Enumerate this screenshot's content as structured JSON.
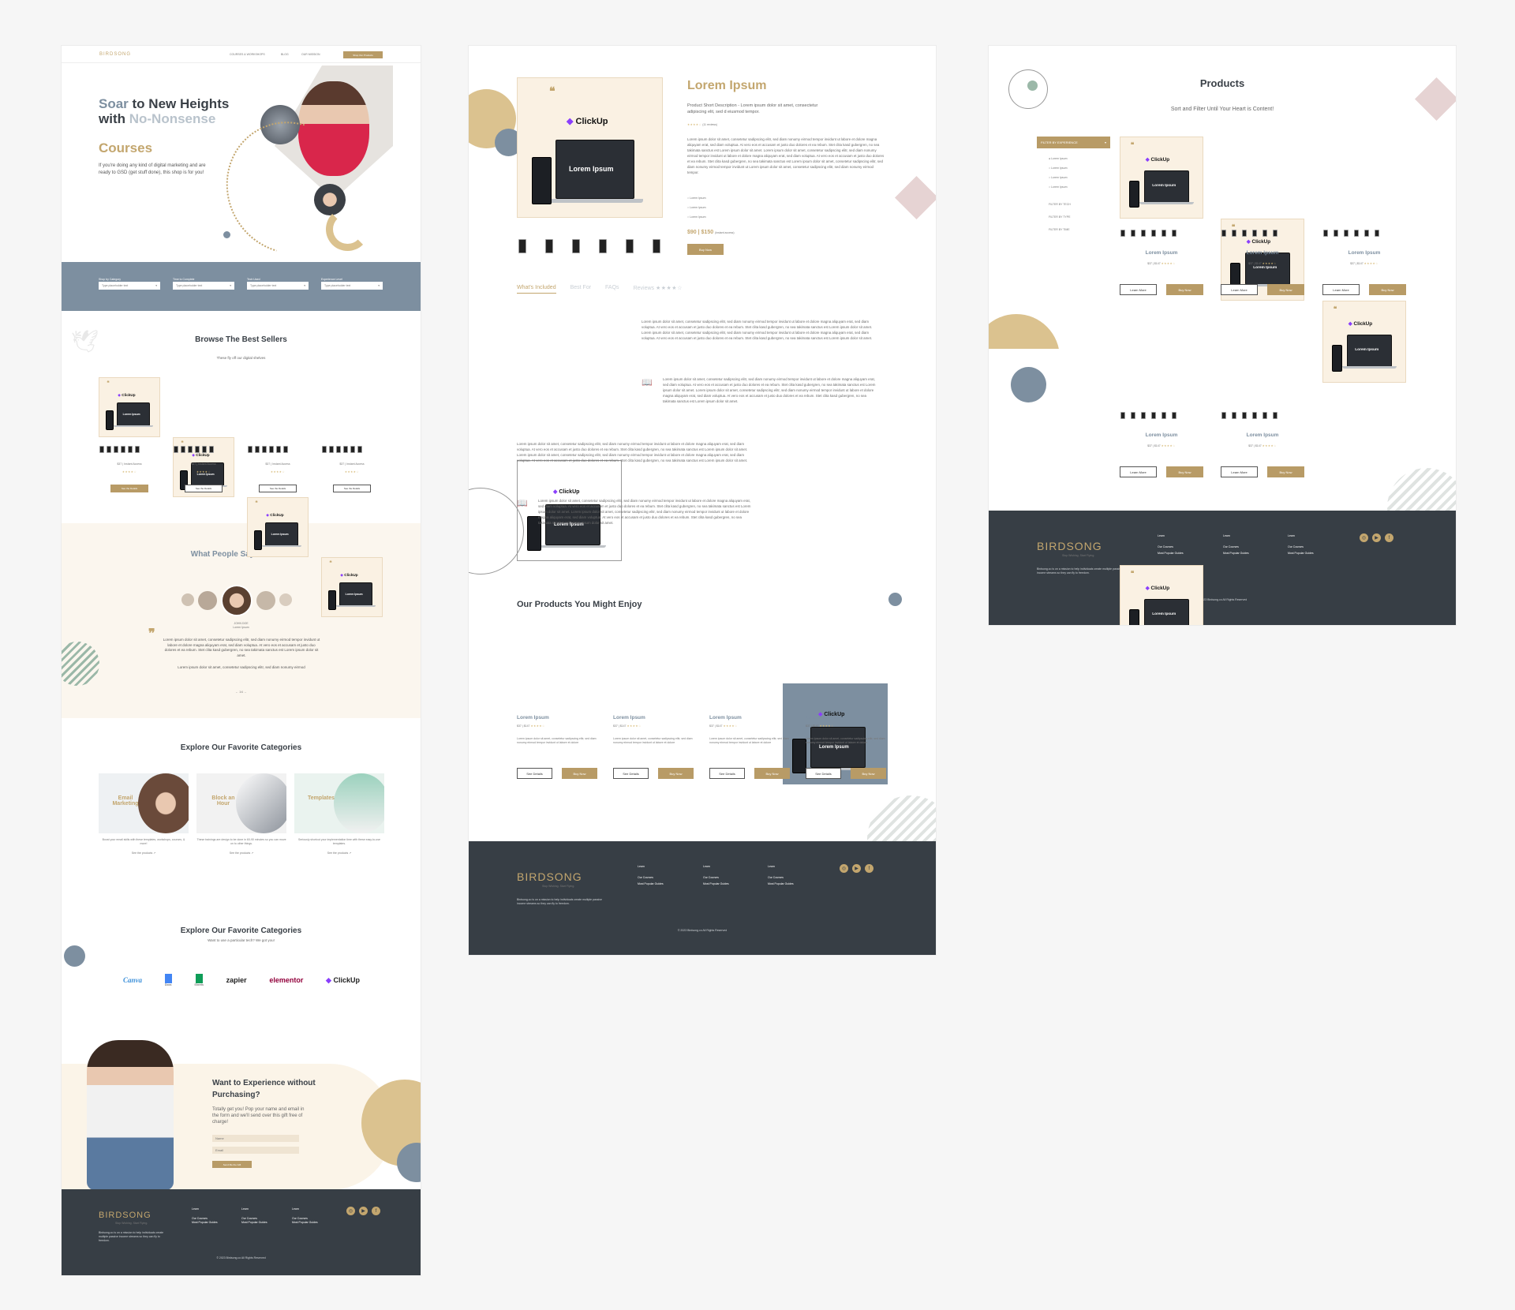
{
  "colors": {
    "gold": "#c3a66e",
    "slate": "#7d8fa0",
    "dark": "#373e45",
    "cream": "#faf1e3",
    "bg": "#f6f6f6"
  },
  "brand": {
    "name": "BIRDSONG",
    "tagline": "Stop Wishing. Start Flying.",
    "blurb": "Birdsong.co is on a mission to help individuals create multiple passive income streams so they can fly to freedom."
  },
  "nav": {
    "items": [
      "COURSES & WORKSHOPS",
      "BLOG",
      "OUR MISSION"
    ],
    "cta": "Shop Our Products"
  },
  "hero": {
    "w1": "Soar",
    "w2": " to New Heights",
    "w3": "with ",
    "w4": "No-Nonsense",
    "w5": "Courses",
    "text": "If you're doing any kind of digital marketing and are ready to GSD (get stuff done), this shop is for you!"
  },
  "filterbar": {
    "fields": [
      {
        "label": "Shop by Category",
        "placeholder": "Type placeholder text"
      },
      {
        "label": "Time to Complete",
        "placeholder": "Type placeholder text"
      },
      {
        "label": "Tech Used",
        "placeholder": "Type placeholder text"
      },
      {
        "label": "Experience Level",
        "placeholder": "Type placeholder text"
      }
    ]
  },
  "bestsellers": {
    "title": "Browse The Best Sellers",
    "subtitle": "These fly off our digital shelves",
    "price": "$37 | Instant Access",
    "button": "See the Details"
  },
  "product_img": {
    "brand": "ClickUp",
    "title": "Lorem Ipsum"
  },
  "testimonials": {
    "title": "What People Say About Us",
    "name": "JOHN DOE",
    "role": "Lorem Ipsum",
    "q1": "Lorem ipsum dolor sit amet, consetetur sadipscing elitr, sed diam nonumy eirmod tempor invidunt ut labore et dolore magna aliquyam erat, sed diam voluptua. At vero eos et accusam et justo duo dolores et ea rebum. Stet clita kasd gubergren, no sea takimata sanctus est Lorem ipsum dolor sit amet.",
    "q2": "Lorem ipsum dolor sit amet, consetetur sadipscing elitr, sed diam nonumy eirmod",
    "pager": "1/4"
  },
  "categories": {
    "title": "Explore Our Favorite Categories",
    "cards": [
      {
        "label": "Email Marketing",
        "text": "Boost your email skills with these templates, workshops, courses, & more!",
        "link": "See the products"
      },
      {
        "label": "Block an Hour",
        "text": "These trainings are design to be done in 60-90 minutes so you can move on to other things.",
        "link": "See the products"
      },
      {
        "label": "Templates",
        "text": "Seriously shortcut your implementation time with these easy-to-use templates.",
        "link": "See the products"
      }
    ]
  },
  "tech": {
    "title": "Explore Our Favorite Categories",
    "subtitle": "Want to use a particular tech? We got you!",
    "logos": [
      "Canva",
      "Docs",
      "Sheets",
      "zapier",
      "elementor",
      "ClickUp"
    ]
  },
  "optin": {
    "title": "Want to Experience without Purchasing?",
    "text": "Totally get you! Pop your name and email in the form and we'll send over this gift free of charge!",
    "name_ph": "Name",
    "email_ph": "Email",
    "button": "Send Me the Gift"
  },
  "footer": {
    "col_head": "Learn",
    "links": [
      "Our Courses",
      "Most Popular Guides"
    ],
    "copyright": "© 2023 Birdsong.co All Rights Reserved"
  },
  "pdp": {
    "title": "Lorem Ipsum",
    "short": "Product Short Description - Lorem ipsum dolor sit amet, consectetur adipiscing elit, sed d eiusmod tempor.",
    "reviews": "(11 reviews)",
    "body": "Lorem ipsum dolor sit amet, consetetur sadipscing elitr, sed diam nonumy eirmod tempor invidunt ut labore et dolore magna aliquyam erat, sed diam voluptua. At vero eos et accusam et justo duo dolores et ea rebum. Stet clita kasd gubergren, no sea takimata sanctus est Lorem ipsum dolor sit amet. Lorem ipsum dolor sit amet, consetetur sadipscing elitr, sed diam nonumy eirmod tempor invidunt ut labore et dolore magna aliquyam erat, sed diam voluptua. At vero eos et accusam et justo duo dolores et ea rebum. Stet clita kasd gubergren, no sea takimata sanctus est Lorem ipsum dolor sit amet, consetetur sadipscing elitr, sed diam nonumy eirmod tempor invidunt ut Lorem ipsum dolor sit amet, consetetur sadipscing elitr, sed diam nonumy eirmod tempor.",
    "bullets": [
      "Lorem Ipsum",
      "Lorem Ipsum",
      "Lorem Ipsum"
    ],
    "price": "$90 | $150",
    "access": "(instant access)",
    "buy": "Buy Now",
    "tabs": [
      "What's Included",
      "Best For",
      "FAQs",
      "Reviews"
    ],
    "para1": "Lorem ipsum dolor sit amet, consetetur sadipscing elitr, sed diam nonumy eirmod tempor invidunt ut labore et dolore magna aliquyam erat, sed diam voluptua. At vero eos et accusam et justo duo dolores et ea rebum. Stet clita kasd gubergren, no sea takimata sanctus est Lorem ipsum dolor sit amet. Lorem ipsum dolor sit amet, consetetur sadipscing elitr, sed diam nonumy eirmod tempor invidunt ut labore et dolore magna aliquyam erat, sed diam voluptua. At vero eos et accusam et justo duo dolores et ea rebum. Stet clita kasd gubergren, no sea takimata sanctus est Lorem ipsum dolor sit amet.",
    "para2": "Lorem ipsum dolor sit amet, consetetur sadipscing elitr, sed diam nonumy eirmod tempor invidunt ut labore et dolore magna aliquyam erat, sed diam voluptua. At vero eos et accusam et justo duo dolores et ea rebum. Stet clita kasd gubergren, no sea takimata sanctus est Lorem ipsum dolor sit amet. Lorem ipsum dolor sit amet, consetetur sadipscing elitr, sed diam nonumy eirmod tempor invidunt ut labore et dolore magna aliquyam erat, sed diam voluptua. At vero eos et accusam et justo duo dolores et ea rebum. Stet clita kasd gubergren, no sea takimata sanctus est Lorem ipsum dolor sit amet.",
    "related_title": "Our Products You Might Enjoy",
    "related_name": "Lorem Ipsum",
    "related_price": "$37 | $147",
    "related_text": "Lorem ipsum dolor sit amet, consetetur sadipscing elitr, sed diam nonumy eirmod tempor invidunt ut labore et dolore",
    "see": "See Details",
    "buy2": "Buy Now"
  },
  "shop": {
    "title": "Products",
    "subtitle": "Sort and Filter Until Your Heart is Content!",
    "filter_head": "FILTER BY EXPERIENCE",
    "options": [
      "Lorem Ipsum",
      "Lorem Ipsum",
      "Lorem Ipsum",
      "Lorem Ipsum"
    ],
    "more_filters": [
      "FILTER BY TECH",
      "FILTER BY TYPE",
      "FILTER BY TIME"
    ],
    "name": "Lorem Ipsum",
    "price": "$37 | $147",
    "learn": "Learn More",
    "buy": "Buy Now"
  }
}
